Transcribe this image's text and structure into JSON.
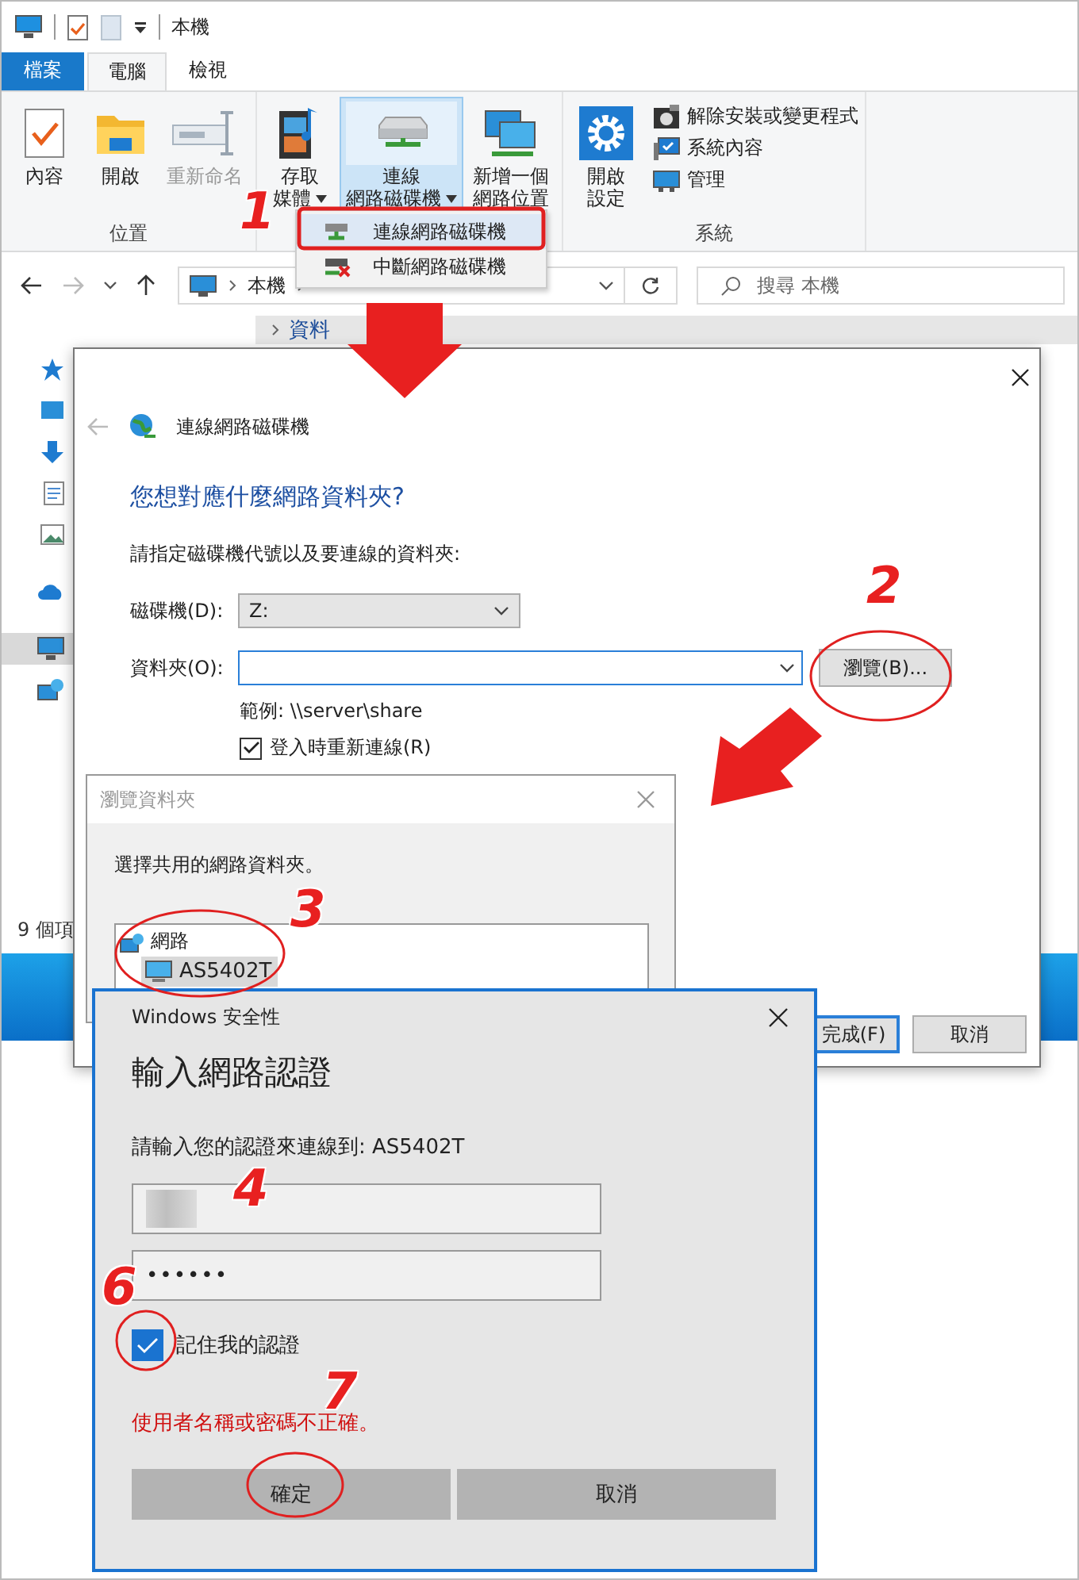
{
  "explorer": {
    "title": "本機",
    "tabs": [
      {
        "label": "檔案",
        "kind": "file",
        "selected": false
      },
      {
        "label": "電腦",
        "kind": "tab",
        "selected": true
      },
      {
        "label": "檢視",
        "kind": "tab",
        "selected": false
      }
    ],
    "ribbon_groups": [
      {
        "label": "位置",
        "commands": [
          {
            "lines": [
              "內容"
            ],
            "kind": "properties",
            "disabled": false,
            "dropdown": false,
            "highlighted": false
          },
          {
            "lines": [
              "開啟"
            ],
            "kind": "open",
            "disabled": false,
            "dropdown": false,
            "highlighted": false
          },
          {
            "lines": [
              "重新命名"
            ],
            "kind": "rename",
            "disabled": true,
            "dropdown": false,
            "highlighted": false
          }
        ]
      },
      {
        "commands": [
          {
            "lines": [
              "存取",
              "媒體"
            ],
            "kind": "media",
            "disabled": false,
            "dropdown": true,
            "highlighted": false
          },
          {
            "lines": [
              "連線",
              "網路磁碟機"
            ],
            "kind": "map-drive",
            "disabled": false,
            "dropdown": true,
            "highlighted": true
          },
          {
            "lines": [
              "新增一個",
              "網路位置"
            ],
            "kind": "network-location",
            "disabled": false,
            "dropdown": false,
            "highlighted": false
          }
        ]
      },
      {
        "label": "系統",
        "commands": [
          {
            "lines": [
              "開啟",
              "設定"
            ],
            "kind": "settings",
            "disabled": false,
            "dropdown": false,
            "highlighted": false
          }
        ],
        "small_commands": [
          {
            "label": "解除安裝或變更程式",
            "kind": "uninstall"
          },
          {
            "label": "系統內容",
            "kind": "system-properties"
          },
          {
            "label": "管理",
            "kind": "manage"
          }
        ]
      }
    ],
    "dropdown_menu": [
      {
        "label": "連線網路磁碟機",
        "kind": "map-drive",
        "highlighted": true
      },
      {
        "label": "中斷網路磁碟機",
        "kind": "disconnect-drive",
        "highlighted": false
      }
    ],
    "address": {
      "crumbs": [
        "本機"
      ],
      "search_placeholder": "搜尋 本機"
    },
    "nav_pane": [
      {
        "kind": "quick-access",
        "selected": false
      },
      {
        "kind": "desktop",
        "selected": false
      },
      {
        "kind": "downloads",
        "selected": false
      },
      {
        "kind": "documents",
        "selected": false
      },
      {
        "kind": "pictures",
        "selected": false
      },
      {
        "kind": "onedrive",
        "selected": false
      },
      {
        "kind": "this-pc",
        "selected": true
      },
      {
        "kind": "network",
        "selected": false
      }
    ],
    "column_header": "資料",
    "status_bar": "9 個項"
  },
  "map_drive_dialog": {
    "title": "連線網路磁碟機",
    "heading": "您想對應什麼網路資料夾?",
    "instruction": "請指定磁碟機代號以及要連線的資料夾:",
    "drive_label": "磁碟機(D):",
    "drive_value": "Z:",
    "folder_label": "資料夾(O):",
    "browse_button": "瀏覽(B)...",
    "example": "範例: \\\\server\\share",
    "reconnect": {
      "label": "登入時重新連線(R)",
      "checked": true
    },
    "buttons": [
      "完成(F)",
      "取消"
    ]
  },
  "browse_dialog": {
    "title": "瀏覽資料夾",
    "instruction": "選擇共用的網路資料夾。",
    "tree": [
      {
        "label": "網路",
        "selected": false,
        "children": [
          {
            "label": "AS5402T",
            "selected": true
          }
        ]
      }
    ]
  },
  "security_dialog": {
    "app": "Windows 安全性",
    "heading": "輸入網路認證",
    "prompt": "請輸入您的認證來連線到: AS5402T",
    "password": "••••••",
    "remember": {
      "label": "記住我的認證",
      "checked": true
    },
    "error": "使用者名稱或密碼不正確。",
    "buttons": [
      "確定",
      "取消"
    ]
  },
  "annotations": [
    {
      "label": "1"
    },
    {
      "label": "2"
    },
    {
      "label": "3"
    },
    {
      "label": "4"
    },
    {
      "label": "6"
    },
    {
      "label": "7"
    }
  ]
}
